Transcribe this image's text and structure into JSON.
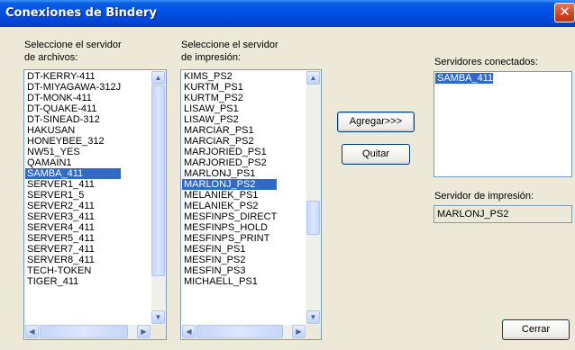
{
  "window": {
    "title": "Conexiones de Bindery",
    "close_glyph": "✕"
  },
  "file_servers": {
    "label_line1": "Seleccione el servidor",
    "label_line2": "de archivos:",
    "items": [
      "DT-KERRY-411",
      "DT-MIYAGAWA-312J",
      "DT-MONK-411",
      "DT-QUAKE-411",
      "DT-SINEAD-312",
      "HAKUSAN",
      "HONEYBEE_312",
      "NW51_YES",
      "QAMAIN1",
      "SAMBA_411",
      "SERVER1_411",
      "SERVER1_5",
      "SERVER2_411",
      "SERVER3_411",
      "SERVER4_411",
      "SERVER5_411",
      "SERVER7_411",
      "SERVER8_411",
      "TECH-TOKEN",
      "TIGER_411"
    ],
    "selected": "SAMBA_411"
  },
  "print_servers": {
    "label_line1": "Seleccione el servidor",
    "label_line2": "de impresión:",
    "items": [
      "KIMS_PS2",
      "KURTM_PS1",
      "KURTM_PS2",
      "LISAW_PS1",
      "LISAW_PS2",
      "MARCIAR_PS1",
      "MARCIAR_PS2",
      "MARJORIED_PS1",
      "MARJORIED_PS2",
      "MARLONJ_PS1",
      "MARLONJ_PS2",
      "MELANIEK_PS1",
      "MELANIEK_PS2",
      "MESFINPS_DIRECT",
      "MESFINPS_HOLD",
      "MESFINPS_PRINT",
      "MESFIN_PS1",
      "MESFIN_PS2",
      "MESFIN_PS3",
      "MICHAELL_PS1"
    ],
    "selected": "MARLONJ_PS2"
  },
  "buttons": {
    "add": "Agregar>>>",
    "remove": "Quitar",
    "close": "Cerrar"
  },
  "connected": {
    "label": "Servidores conectados:",
    "items": [
      "SAMBA_411"
    ],
    "selected": "SAMBA_411"
  },
  "print_server_field": {
    "label": "Servidor de impresión:",
    "value": "MARLONJ_PS2"
  },
  "scrollbar_glyphs": {
    "up": "▲",
    "down": "▼",
    "left": "◀",
    "right": "▶"
  },
  "colors": {
    "titlebar": "#0050e6",
    "selection": "#316ac5",
    "dialog_bg": "#ece9d8"
  }
}
